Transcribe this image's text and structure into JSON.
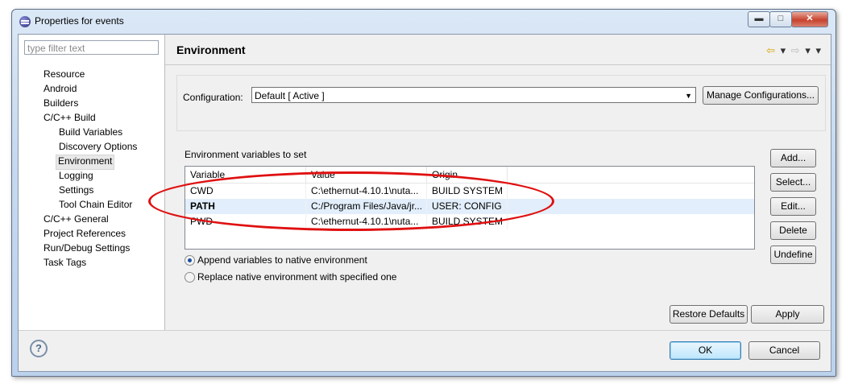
{
  "window": {
    "title": "Properties for events",
    "min_label": "▬",
    "max_label": "□",
    "close_label": "✕"
  },
  "filter": {
    "placeholder": "type filter text"
  },
  "tree": [
    "Resource",
    "Android",
    "Builders",
    "C/C++ Build",
    "Build Variables",
    "Discovery Options",
    "Environment",
    "Logging",
    "Settings",
    "Tool Chain Editor",
    "C/C++ General",
    "Project References",
    "Run/Debug Settings",
    "Task Tags"
  ],
  "page": {
    "title": "Environment",
    "nav_back": "⇦",
    "nav_fwd": "⇨",
    "dropdown": "▾"
  },
  "config": {
    "label": "Configuration:",
    "value": "Default  [ Active ]",
    "manage_button": "Manage Configurations..."
  },
  "env": {
    "section_label": "Environment variables to set",
    "headers": [
      "Variable",
      "Value",
      "Origin"
    ],
    "rows": [
      [
        "CWD",
        "C:\\ethernut-4.10.1\\nuta...",
        "BUILD SYSTEM"
      ],
      [
        "PATH",
        "C:/Program Files/Java/jr...",
        "USER: CONFIG"
      ],
      [
        "PWD",
        "C:\\ethernut-4.10.1\\nuta...",
        "BUILD SYSTEM"
      ]
    ],
    "buttons": {
      "add": "Add...",
      "select": "Select...",
      "edit": "Edit...",
      "delete": "Delete",
      "undefine": "Undefine"
    }
  },
  "options": {
    "append": "Append variables to native environment",
    "replace": "Replace native environment with specified one"
  },
  "footer": {
    "restore": "Restore Defaults",
    "apply": "Apply",
    "ok": "OK",
    "cancel": "Cancel",
    "help": "?"
  },
  "colors": {
    "annotation": "#e01010",
    "selection": "#e2eefb"
  }
}
